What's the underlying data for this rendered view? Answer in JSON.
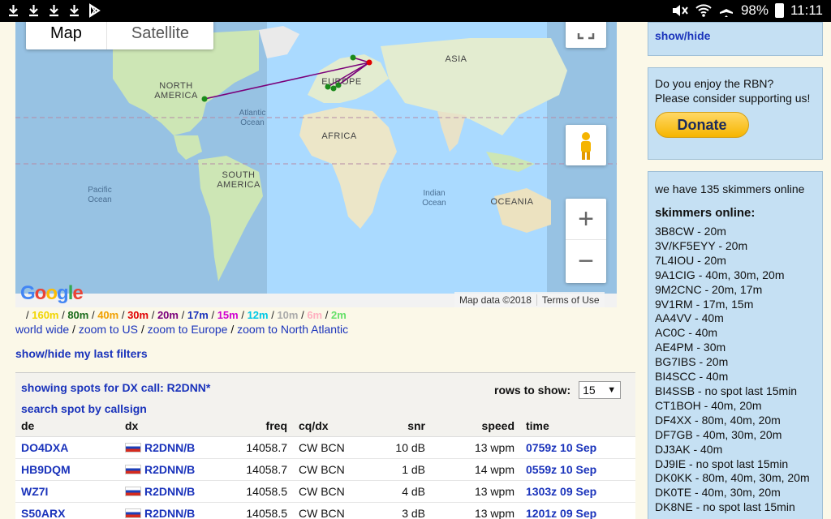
{
  "status_bar": {
    "battery": "98%",
    "time": "11:11"
  },
  "map": {
    "tab_map": "Map",
    "tab_satellite": "Satellite",
    "attribution": "Map data ©2018",
    "terms": "Terms of Use",
    "google": "Google",
    "labels": {
      "north_america": "NORTH AMERICA",
      "south_america": "SOUTH AMERICA",
      "europe": "EUROPE",
      "asia": "ASIA",
      "africa": "AFRICA",
      "oceania": "OCEANIA",
      "atlantic": "Atlantic Ocean",
      "pacific": "Pacific Ocean",
      "indian": "Indian Ocean"
    }
  },
  "bands": [
    {
      "label": "160m",
      "color": "#f2d500"
    },
    {
      "label": "80m",
      "color": "#1a6b1a"
    },
    {
      "label": "40m",
      "color": "#f0a000"
    },
    {
      "label": "30m",
      "color": "#e00000"
    },
    {
      "label": "20m",
      "color": "#7a007a"
    },
    {
      "label": "17m",
      "color": "#1a33bb"
    },
    {
      "label": "15m",
      "color": "#d000d0"
    },
    {
      "label": "12m",
      "color": "#00c8e6"
    },
    {
      "label": "10m",
      "color": "#aaaaaa"
    },
    {
      "label": "6m",
      "color": "#ffb0c0"
    },
    {
      "label": "2m",
      "color": "#66e06a"
    }
  ],
  "zoom_links": {
    "world": "world wide",
    "us": "zoom to US",
    "europe": "zoom to Europe",
    "na": "zoom to North Atlantic"
  },
  "filters_link": "show/hide my last filters",
  "spots": {
    "showing": "showing spots for DX call: R2DNN*",
    "search": "search spot by callsign",
    "rows_label": "rows to show:",
    "rows_value": "15",
    "columns": [
      "de",
      "dx",
      "freq",
      "cq/dx",
      "snr",
      "speed",
      "time"
    ],
    "rows": [
      {
        "de": "DO4DXA",
        "dx": "R2DNN/B",
        "freq": "14058.7",
        "cq": "CW BCN",
        "snr": "10 dB",
        "speed": "13 wpm",
        "time": "0759z 10 Sep"
      },
      {
        "de": "HB9DQM",
        "dx": "R2DNN/B",
        "freq": "14058.7",
        "cq": "CW BCN",
        "snr": "1 dB",
        "speed": "14 wpm",
        "time": "0559z 10 Sep"
      },
      {
        "de": "WZ7I",
        "dx": "R2DNN/B",
        "freq": "14058.5",
        "cq": "CW BCN",
        "snr": "4 dB",
        "speed": "13 wpm",
        "time": "1303z 09 Sep"
      },
      {
        "de": "S50ARX",
        "dx": "R2DNN/B",
        "freq": "14058.5",
        "cq": "CW BCN",
        "snr": "3 dB",
        "speed": "13 wpm",
        "time": "1201z 09 Sep"
      }
    ]
  },
  "sidebar": {
    "show_hide": "show/hide",
    "enjoy_line1": "Do you enjoy the RBN?",
    "enjoy_line2": "Please consider supporting us!",
    "donate": "Donate",
    "skimmer_count": "we have 135 skimmers online",
    "skimmers_title": "skimmers online:",
    "skimmers": [
      "3B8CW - 20m",
      "3V/KF5EYY - 20m",
      "7L4IOU - 20m",
      "9A1CIG - 40m, 30m, 20m",
      "9M2CNC - 20m, 17m",
      "9V1RM - 17m, 15m",
      "AA4VV - 40m",
      "AC0C - 40m",
      "AE4PM - 30m",
      "BG7IBS - 20m",
      "BI4SCC - 40m",
      "BI4SSB - no spot last 15min",
      "CT1BOH - 40m, 20m",
      "DF4XX - 80m, 40m, 20m",
      "DF7GB - 40m, 30m, 20m",
      "DJ3AK - 40m",
      "DJ9IE - no spot last 15min",
      "DK0KK - 80m, 40m, 30m, 20m",
      "DK0TE - 40m, 30m, 20m",
      "DK8NE - no spot last 15min"
    ]
  }
}
